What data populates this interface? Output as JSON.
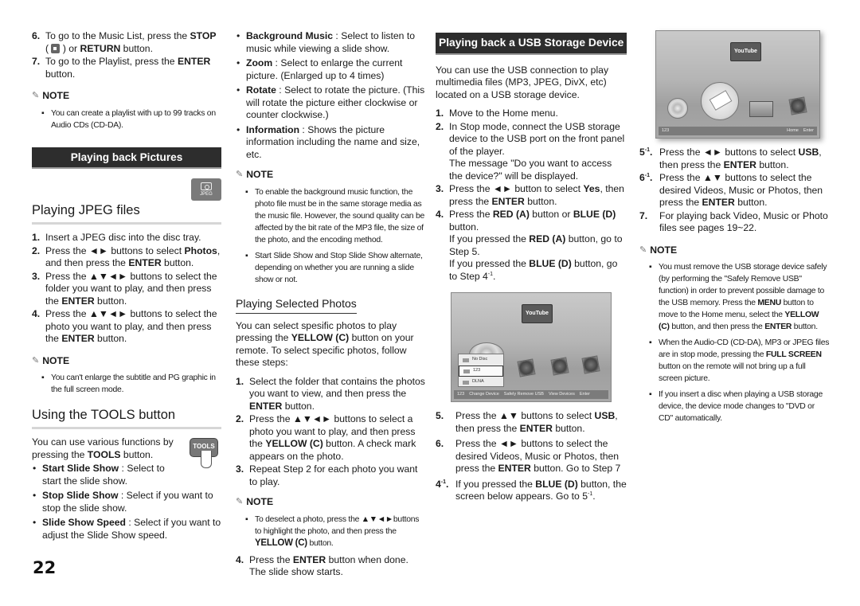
{
  "page_number": "22",
  "col1": {
    "steps_top": [
      {
        "num": "6.",
        "pre": "To go to the Music List, press the ",
        "b1": "STOP",
        "mid": " ( ",
        "icon": "stop-icon",
        "post": " ) or ",
        "b2": "RETURN",
        "end": " button."
      },
      {
        "num": "7.",
        "pre": "To go to the Playlist, press the ",
        "b1": "ENTER",
        "end": " button."
      }
    ],
    "note1": {
      "label": "NOTE",
      "items": [
        "You can create a playlist with up to 99 tracks on Audio CDs (CD-DA)."
      ]
    },
    "section_title": "Playing back Pictures",
    "jpeg_badge": "JPEG",
    "jpeg_heading": "Playing JPEG files",
    "jpeg_steps": [
      {
        "num": "1.",
        "text": "Insert a JPEG disc into the disc tray."
      },
      {
        "num": "2.",
        "pre": "Press the ◄► buttons to select ",
        "b1": "Photos",
        "mid": ", and then press the ",
        "b2": "ENTER",
        "end": " button."
      },
      {
        "num": "3.",
        "pre": "Press the ▲▼◄► buttons to select the folder you want to play, and then press the ",
        "b1": "ENTER",
        "end": " button."
      },
      {
        "num": "4.",
        "pre": "Press the ▲▼◄► buttons to select the photo you want to play, and then press the ",
        "b1": "ENTER",
        "end": " button."
      }
    ],
    "note2": {
      "label": "NOTE",
      "items": [
        "You can't enlarge the subtitle and PG graphic in the full screen mode."
      ]
    },
    "tools_heading": "Using the TOOLS button",
    "tools_intro_pre": "You can use various functions by pressing the ",
    "tools_intro_b": "TOOLS",
    "tools_intro_end": " button.",
    "tools_button_label": "TOOLS",
    "tools_items": [
      {
        "b": "Start Slide Show",
        "text": " : Select to start the slide show."
      },
      {
        "b": "Stop Slide Show",
        "text": " : Select if you want to stop the slide show."
      },
      {
        "b": "Slide Show Speed",
        "text": " : Select if you want to adjust the Slide Show speed."
      }
    ]
  },
  "col2": {
    "tools_items": [
      {
        "b": "Background Music",
        "text": " : Select to listen to music while viewing a slide show."
      },
      {
        "b": "Zoom",
        "text": " : Select to enlarge the current picture. (Enlarged up to 4 times)"
      },
      {
        "b": "Rotate",
        "text": " : Select to rotate the picture. (This will rotate the picture either clockwise or counter clockwise.)"
      },
      {
        "b": "Information",
        "text": " : Shows the picture information including the name and size, etc."
      }
    ],
    "note1": {
      "label": "NOTE",
      "items": [
        "To enable the background music function, the photo file must be in the same storage media as the music file. However, the sound quality can be affected by the bit rate of the MP3 file, the size of the photo, and the encoding method.",
        "Start Slide Show and Stop Slide Show alternate, depending on whether you are running a slide show or not."
      ]
    },
    "selected_heading": "Playing Selected Photos",
    "selected_intro": {
      "pre": "You can select spesific photos to play pressing the ",
      "b": "YELLOW (C)",
      "end": " button on your remote. To select specific photos, follow these steps:"
    },
    "selected_steps": [
      {
        "num": "1.",
        "pre": "Select the folder that contains the photos you want to view, and then press the ",
        "b1": "ENTER",
        "end": " button."
      },
      {
        "num": "2.",
        "pre": "Press the ▲▼◄► buttons to select a photo you want to play, and then press the ",
        "b1": "YELLOW (C)",
        "end": " button. A check mark appears on the photo."
      },
      {
        "num": "3.",
        "text": "Repeat Step  2 for each photo you want to play."
      }
    ],
    "note2": {
      "label": "NOTE",
      "pre": "To deselect a photo, press the ▲▼◄►buttons to highlight the photo, and then press the ",
      "b": "YELLOW (C)",
      "end": " button."
    },
    "step4": {
      "num": "4.",
      "pre": "Press the ",
      "b1": "ENTER",
      "end": " button when done. The slide show starts."
    }
  },
  "col3": {
    "section_title": "Playing back a USB Storage Device",
    "intro": "You can use the USB connection to play multimedia files (MP3, JPEG, DivX, etc) located on a USB storage device.",
    "steps": [
      {
        "num": "1.",
        "text": "Move to the Home menu."
      },
      {
        "num": "2.",
        "text": "In Stop mode, connect the USB storage device to the USB port on the front panel of the player.",
        "text2": "The message \"Do you want to access the device?\" will be displayed."
      },
      {
        "num": "3.",
        "pre": "Press the ◄► button to select ",
        "b1": "Yes",
        "mid": ", then press the ",
        "b2": "ENTER",
        "end": " button."
      },
      {
        "num": "4.",
        "pre": "Press the ",
        "b1": "RED (A)",
        "mid": " button or ",
        "b2": "BLUE (D)",
        "end": " button."
      }
    ],
    "step4_lines": [
      {
        "pre": "If you pressed the ",
        "b": "RED (A)",
        "end": " button, go to Step 5."
      },
      {
        "pre": "If you pressed the ",
        "b": "BLUE (D)",
        "end": " button, go to Step 4",
        "sup": "-1",
        "tail": "."
      }
    ],
    "screen": {
      "youtube": "YouTube",
      "devices": [
        "No Disc",
        "123",
        "DLNA"
      ],
      "selected_device": "123",
      "bar": [
        "123",
        "Change Device",
        "Safely Remove USB",
        "View Devices",
        "Enter"
      ]
    },
    "steps_after": [
      {
        "num": "5.",
        "pre": "Press the ▲▼ buttons to select ",
        "b1": "USB",
        "mid": ", then press the ",
        "b2": "ENTER",
        "end": " button."
      },
      {
        "num": "6.",
        "pre": "Press the ◄► buttons to select the desired Videos, Music or Photos, then press the ",
        "b1": "ENTER",
        "end": " button. Go to Step 7"
      },
      {
        "num": "4",
        "numsup": "-1",
        "pre": "If you pressed the ",
        "b1": "BLUE (D)",
        "end": " button, the screen below appears. Go to 5",
        "sup": "-1",
        "tail": "."
      }
    ]
  },
  "col4": {
    "screen": {
      "youtube": "YouTube",
      "bar_left": "123",
      "bar_right": [
        "Home",
        "Enter"
      ]
    },
    "steps": [
      {
        "num": "5",
        "numsup": "-1",
        "pre": "Press the ◄► buttons to select ",
        "b1": "USB",
        "mid": ", then press the ",
        "b2": "ENTER",
        "end": " button."
      },
      {
        "num": "6",
        "numsup": "-1",
        "pre": "Press the ▲▼ buttons to select the desired  Videos, Music or Photos, then press the ",
        "b1": "ENTER",
        "end": " button."
      },
      {
        "num": "7.",
        "text": "For playing back Video, Music or Photo files see pages 19~22."
      }
    ],
    "note": {
      "label": "NOTE",
      "items": [
        {
          "pre": "You must remove the USB storage device safely (by performing the \"Safely Remove USB\" function) in order to prevent possible damage to the USB memory. Press the ",
          "b1": "MENU",
          "mid": " button to move to the Home menu, select the ",
          "b2": "YELLOW (C)",
          "mid2": " button, and then press the ",
          "b3": "ENTER",
          "end": " button."
        },
        {
          "pre": "When the Audio-CD (CD-DA), MP3 or JPEG files are in stop mode, pressing the ",
          "b1": "FULL SCREEN",
          "end": " button on the remote will not bring up a full screen picture."
        },
        {
          "pre": "If you insert a disc when playing a USB storage device, the device mode changes to \"DVD or CD\" automatically."
        }
      ]
    }
  }
}
